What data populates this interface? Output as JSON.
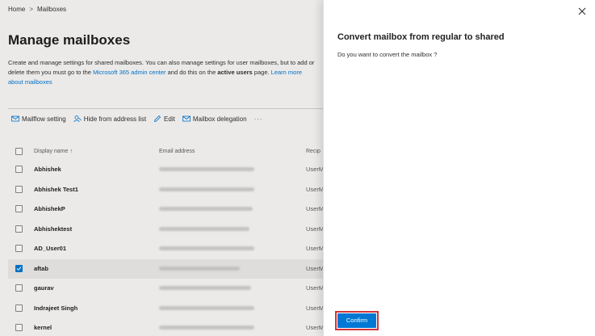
{
  "breadcrumb": {
    "home": "Home",
    "separator": ">",
    "current": "Mailboxes"
  },
  "page": {
    "title": "Manage mailboxes",
    "desc_part1": "Create and manage settings for shared mailboxes. You can also manage settings for user mailboxes, but to add or delete them you must go to the ",
    "desc_link1": "Microsoft 365 admin center",
    "desc_part2": " and do this on the ",
    "desc_bold": "active users",
    "desc_part3": " page. ",
    "desc_link2": "Learn more about mailboxes"
  },
  "toolbar": {
    "mailflow": "Mailflow setting",
    "hide": "Hide from address list",
    "edit": "Edit",
    "delegation": "Mailbox delegation",
    "more": "···"
  },
  "table": {
    "headers": {
      "name": "Display name ↑",
      "email": "Email address",
      "recipient": "Recip"
    },
    "rows": [
      {
        "name": "Abhishek",
        "recipient": "UserM",
        "selected": false
      },
      {
        "name": "Abhishek Test1",
        "recipient": "UserM",
        "selected": false
      },
      {
        "name": "AbhishekP",
        "recipient": "UserM",
        "selected": false
      },
      {
        "name": "Abhishektest",
        "recipient": "UserM",
        "selected": false
      },
      {
        "name": "AD_User01",
        "recipient": "UserM",
        "selected": false
      },
      {
        "name": "aftab",
        "recipient": "UserM",
        "selected": true
      },
      {
        "name": "gaurav",
        "recipient": "UserM",
        "selected": false
      },
      {
        "name": "Indrajeet Singh",
        "recipient": "UserM",
        "selected": false
      },
      {
        "name": "kernel",
        "recipient": "UserM",
        "selected": false
      }
    ]
  },
  "panel": {
    "title": "Convert mailbox from regular to shared",
    "question": "Do you want to convert the mailbox ?",
    "confirm": "Confirm"
  },
  "colors": {
    "accent": "#0078d4",
    "highlight": "#d13438"
  }
}
